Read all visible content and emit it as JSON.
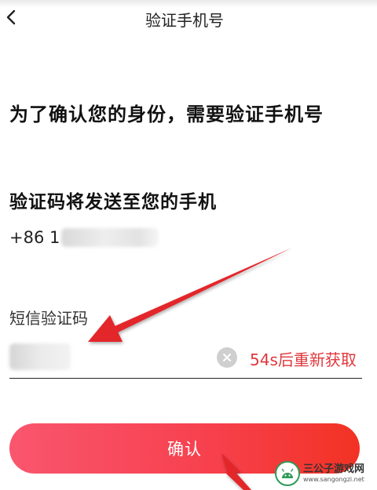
{
  "header": {
    "title": "验证手机号",
    "back_icon": "chevron-left-icon"
  },
  "main": {
    "heading": "为了确认您的身份，需要验证手机号",
    "subheading": "验证码将发送至您的手机",
    "phone_prefix": "+86 1",
    "code_label": "短信验证码",
    "clear_icon": "clear-circle-icon",
    "resend_text": "54s后重新获取",
    "confirm_label": "确认"
  },
  "watermark": {
    "title": "三公子游戏网",
    "url": "www.sangongzi.net"
  },
  "colors": {
    "accent_red": "#e0383d",
    "button_gradient_start": "#f9566e",
    "button_gradient_end": "#f23224",
    "annotation_arrow": "#e3262c"
  }
}
